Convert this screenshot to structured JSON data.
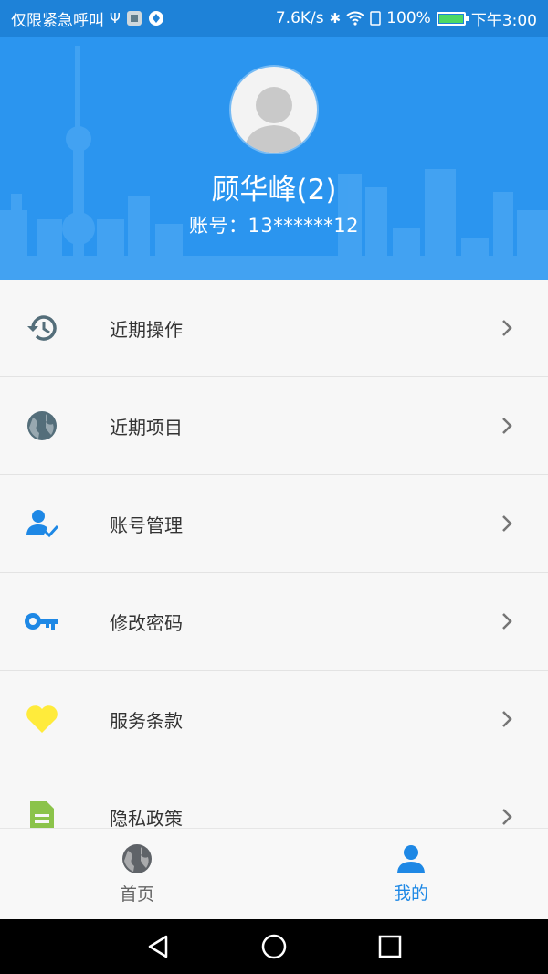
{
  "status_bar": {
    "left_text": "仅限紧急呼叫",
    "speed": "7.6K/s",
    "battery": "100%",
    "time": "下午3:00"
  },
  "profile": {
    "name": "顾华峰(2)",
    "account": "账号：13******12"
  },
  "menu": {
    "items": [
      {
        "label": "近期操作",
        "icon": "history-icon",
        "color": "#546e7a"
      },
      {
        "label": "近期项目",
        "icon": "globe-icon",
        "color": "#546e7a"
      },
      {
        "label": "账号管理",
        "icon": "user-check-icon",
        "color": "#1e88e5"
      },
      {
        "label": "修改密码",
        "icon": "key-icon",
        "color": "#1e88e5"
      },
      {
        "label": "服务条款",
        "icon": "heart-icon",
        "color": "#ffeb3b"
      },
      {
        "label": "隐私政策",
        "icon": "document-icon",
        "color": "#8bc34a"
      }
    ]
  },
  "bottom_nav": {
    "tabs": [
      {
        "label": "首页",
        "icon": "globe-icon",
        "active": false
      },
      {
        "label": "我的",
        "icon": "person-icon",
        "active": true
      }
    ],
    "active_color": "#1e88e5",
    "inactive_color": "#666666"
  },
  "colors": {
    "header_bg": "#2b95ef",
    "status_bg": "#1e82d8"
  }
}
